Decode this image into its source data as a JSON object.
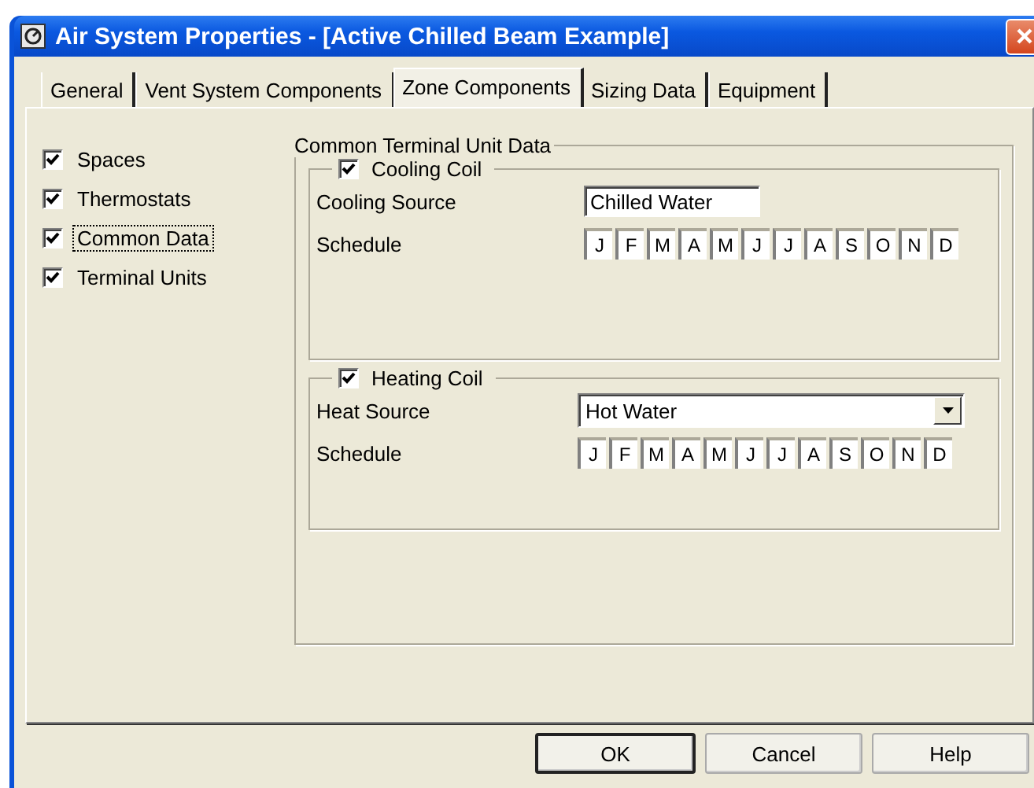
{
  "window": {
    "title": "Air System Properties - [Active Chilled Beam Example]"
  },
  "tabs": [
    {
      "label": "General",
      "selected": false
    },
    {
      "label": "Vent System Components",
      "selected": false
    },
    {
      "label": "Zone Components",
      "selected": true
    },
    {
      "label": "Sizing Data",
      "selected": false
    },
    {
      "label": "Equipment",
      "selected": false
    }
  ],
  "components": [
    {
      "label": "Spaces",
      "checked": true,
      "focused": false
    },
    {
      "label": "Thermostats",
      "checked": true,
      "focused": false
    },
    {
      "label": "Common Data",
      "checked": true,
      "focused": true
    },
    {
      "label": "Terminal Units",
      "checked": true,
      "focused": false
    }
  ],
  "common_terminal_unit_data": {
    "title": "Common Terminal Unit Data",
    "coils": [
      {
        "label": "Cooling Coil",
        "checked": true,
        "source_label": "Cooling Source",
        "source": {
          "kind": "text",
          "value": "Chilled Water"
        },
        "schedule_label": "Schedule",
        "months": [
          "J",
          "F",
          "M",
          "A",
          "M",
          "J",
          "J",
          "A",
          "S",
          "O",
          "N",
          "D"
        ]
      },
      {
        "label": "Heating Coil",
        "checked": true,
        "source_label": "Heat Source",
        "source": {
          "kind": "dropdown",
          "value": "Hot Water"
        },
        "schedule_label": "Schedule",
        "months": [
          "J",
          "F",
          "M",
          "A",
          "M",
          "J",
          "J",
          "A",
          "S",
          "O",
          "N",
          "D"
        ]
      }
    ]
  },
  "buttons": [
    {
      "label": "OK",
      "default": true
    },
    {
      "label": "Cancel",
      "default": false
    },
    {
      "label": "Help",
      "default": false
    }
  ]
}
